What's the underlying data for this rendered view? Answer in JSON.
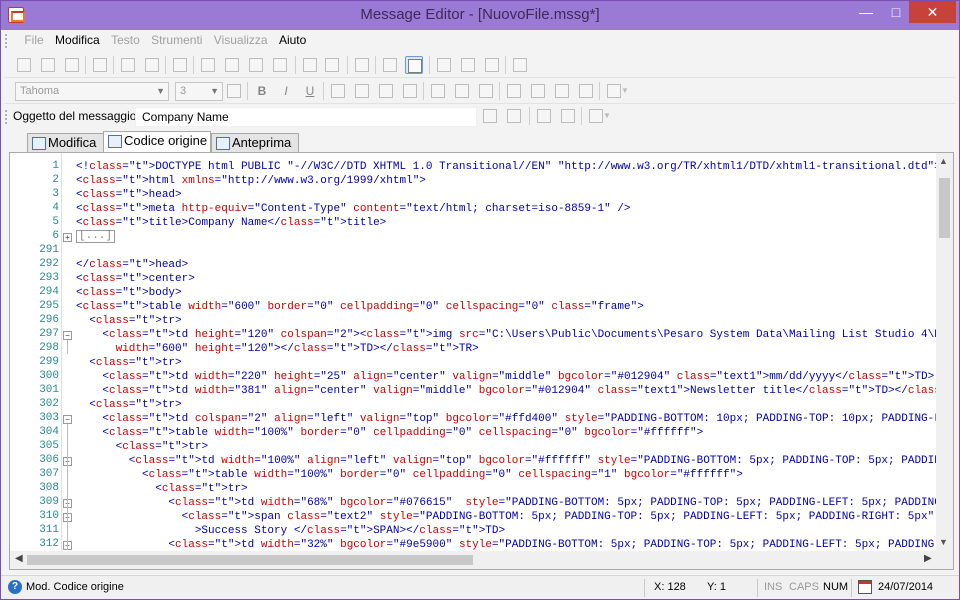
{
  "window": {
    "title": "Message Editor - [NuovoFile.mssg*]"
  },
  "menu": [
    "File",
    "Modifica",
    "Testo",
    "Strumenti",
    "Visualizza",
    "Aiuto"
  ],
  "menu_enabled": [
    false,
    true,
    false,
    false,
    false,
    true
  ],
  "toolbar2": {
    "font": "Tahoma",
    "size": "3"
  },
  "subject": {
    "label": "Oggetto del messaggio:",
    "value": "Company Name"
  },
  "tabs": [
    {
      "label": "Modifica",
      "icon": "edit-icon"
    },
    {
      "label": "Codice origine",
      "icon": "source-code-icon"
    },
    {
      "label": "Anteprima",
      "icon": "preview-icon"
    }
  ],
  "active_tab": "Codice origine",
  "editor": {
    "collapsed_marker": "[...]",
    "lines": [
      {
        "n": "1",
        "text": "<!DOCTYPE html PUBLIC \"-//W3C//DTD XHTML 1.0 Transitional//EN\" \"http://www.w3.org/TR/xhtml1/DTD/xhtml1-transitional.dtd\">"
      },
      {
        "n": "2",
        "text": "<html xmlns=\"http://www.w3.org/1999/xhtml\">"
      },
      {
        "n": "3",
        "text": "<head>"
      },
      {
        "n": "4",
        "text": "<meta http-equiv=\"Content-Type\" content=\"text/html; charset=iso-8859-1\" />"
      },
      {
        "n": "5",
        "text": "<title>Company Name</title>"
      },
      {
        "n": "6",
        "text": ""
      },
      {
        "n": "291",
        "text": ""
      },
      {
        "n": "292",
        "text": "</head>"
      },
      {
        "n": "293",
        "text": "<center>"
      },
      {
        "n": "294",
        "text": "<body>"
      },
      {
        "n": "295",
        "text": "<table width=\"600\" border=\"0\" cellpadding=\"0\" cellspacing=\"0\" class=\"frame\">"
      },
      {
        "n": "296",
        "text": "  <tr>"
      },
      {
        "n": "297",
        "text": "    <td height=\"120\" colspan=\"2\"><img src=\"C:\\Users\\Public\\Documents\\Pesaro System Data\\Mailing List Studio 4\\Elaboration\\2"
      },
      {
        "n": "298",
        "text": "      width=\"600\" height=\"120\"></TD></TR>"
      },
      {
        "n": "299",
        "text": "  <tr>"
      },
      {
        "n": "300",
        "text": "    <td width=\"220\" height=\"25\" align=\"center\" valign=\"middle\" bgcolor=\"#012904\" class=\"text1\">mm/dd/yyyy</TD>"
      },
      {
        "n": "301",
        "text": "    <td width=\"381\" align=\"center\" valign=\"middle\" bgcolor=\"#012904\" class=\"text1\">Newsletter title</TD></TR>"
      },
      {
        "n": "302",
        "text": "  <tr>"
      },
      {
        "n": "303",
        "text": "    <td colspan=\"2\" align=\"left\" valign=\"top\" bgcolor=\"#ffd400\" style=\"PADDING-BOTTOM: 10px; PADDING-TOP: 10px; PADDING-LEF"
      },
      {
        "n": "304",
        "text": "    <table width=\"100%\" border=\"0\" cellpadding=\"0\" cellspacing=\"0\" bgcolor=\"#ffffff\">"
      },
      {
        "n": "305",
        "text": "      <tr>"
      },
      {
        "n": "306",
        "text": "        <td width=\"100%\" align=\"left\" valign=\"top\" bgcolor=\"#ffffff\" style=\"PADDING-BOTTOM: 5px; PADDING-TOP: 5px; PADDING-"
      },
      {
        "n": "307",
        "text": "          <table width=\"100%\" border=\"0\" cellpadding=\"0\" cellspacing=\"1\" bgcolor=\"#ffffff\">"
      },
      {
        "n": "308",
        "text": "            <tr>"
      },
      {
        "n": "309",
        "text": "              <td width=\"68%\" bgcolor=\"#076615\"  style=\"PADDING-BOTTOM: 5px; PADDING-TOP: 5px; PADDING-LEFT: 5px; PADDING-RIG"
      },
      {
        "n": "310",
        "text": "                <span class=\"text2\" style=\"PADDING-BOTTOM: 5px; PADDING-TOP: 5px; PADDING-LEFT: 5px; PADDING-RIGHT: 5px\""
      },
      {
        "n": "311",
        "text": "                  >Success Story </SPAN></TD>"
      },
      {
        "n": "312",
        "text": "              <td width=\"32%\" bgcolor=\"#9e5900\" style=\"PADDING-BOTTOM: 5px; PADDING-TOP: 5px; PADDING-LEFT: 5px; PADDING-RIGH"
      }
    ]
  },
  "status": {
    "mode": "Mod. Codice origine",
    "x": "X: 128",
    "y": "Y: 1",
    "ins": "INS",
    "caps": "CAPS",
    "num": "NUM",
    "date": "24/07/2014"
  },
  "colors": {
    "titlebar": "#9b7ad6",
    "close": "#c7433a",
    "linenumber": "#2b8a8a"
  }
}
